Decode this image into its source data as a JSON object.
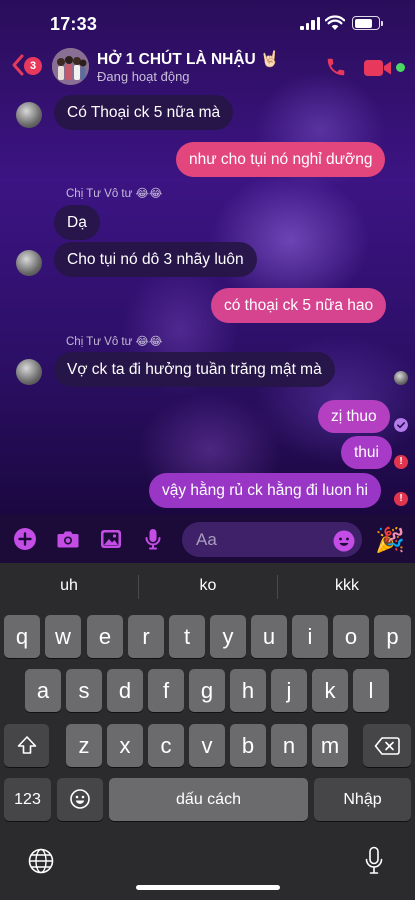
{
  "status_bar": {
    "time": "17:33",
    "battery_level": 0.75
  },
  "header": {
    "back_badge": "3",
    "title": "HỞ 1 CHÚT LÀ NHẬU 🤘🏻",
    "status": "Đang hoạt động",
    "icons": [
      "back-chevron-icon",
      "phone-icon",
      "video-camera-icon"
    ],
    "accent_color": "#e8395c"
  },
  "messages": {
    "m1": "Có Thoại ck 5 nữa mà",
    "m2": "như cho tụi nó nghỉ dưỡng",
    "sender1": "Chị Tư Vô tư 😂😂",
    "m3": "Dạ",
    "m4": "Cho tụi nó dô 3 nhãy luôn",
    "m5": "có thoại ck 5 nữa hao",
    "sender2": "Chị Tư Vô tư 😂😂",
    "m6": "Vợ ck ta đi hưởng tuần trăng mật mà",
    "m7": "zị thuo",
    "m8": "thui",
    "m9": "vậy hằng rủ ck hằng đi luon hi",
    "fail_mark": "!"
  },
  "composer": {
    "placeholder": "Aa",
    "icons": [
      "plus-icon",
      "camera-icon",
      "image-icon",
      "microphone-icon",
      "emoji-icon",
      "party-popper-icon"
    ]
  },
  "keyboard": {
    "suggestions": [
      "uh",
      "ko",
      "kkk"
    ],
    "row1": [
      "q",
      "w",
      "e",
      "r",
      "t",
      "y",
      "u",
      "i",
      "o",
      "p"
    ],
    "row2": [
      "a",
      "s",
      "d",
      "f",
      "g",
      "h",
      "j",
      "k",
      "l"
    ],
    "row3": [
      "z",
      "x",
      "c",
      "v",
      "b",
      "n",
      "m"
    ],
    "numbers_label": "123",
    "space_label": "dấu cách",
    "return_label": "Nhập"
  }
}
